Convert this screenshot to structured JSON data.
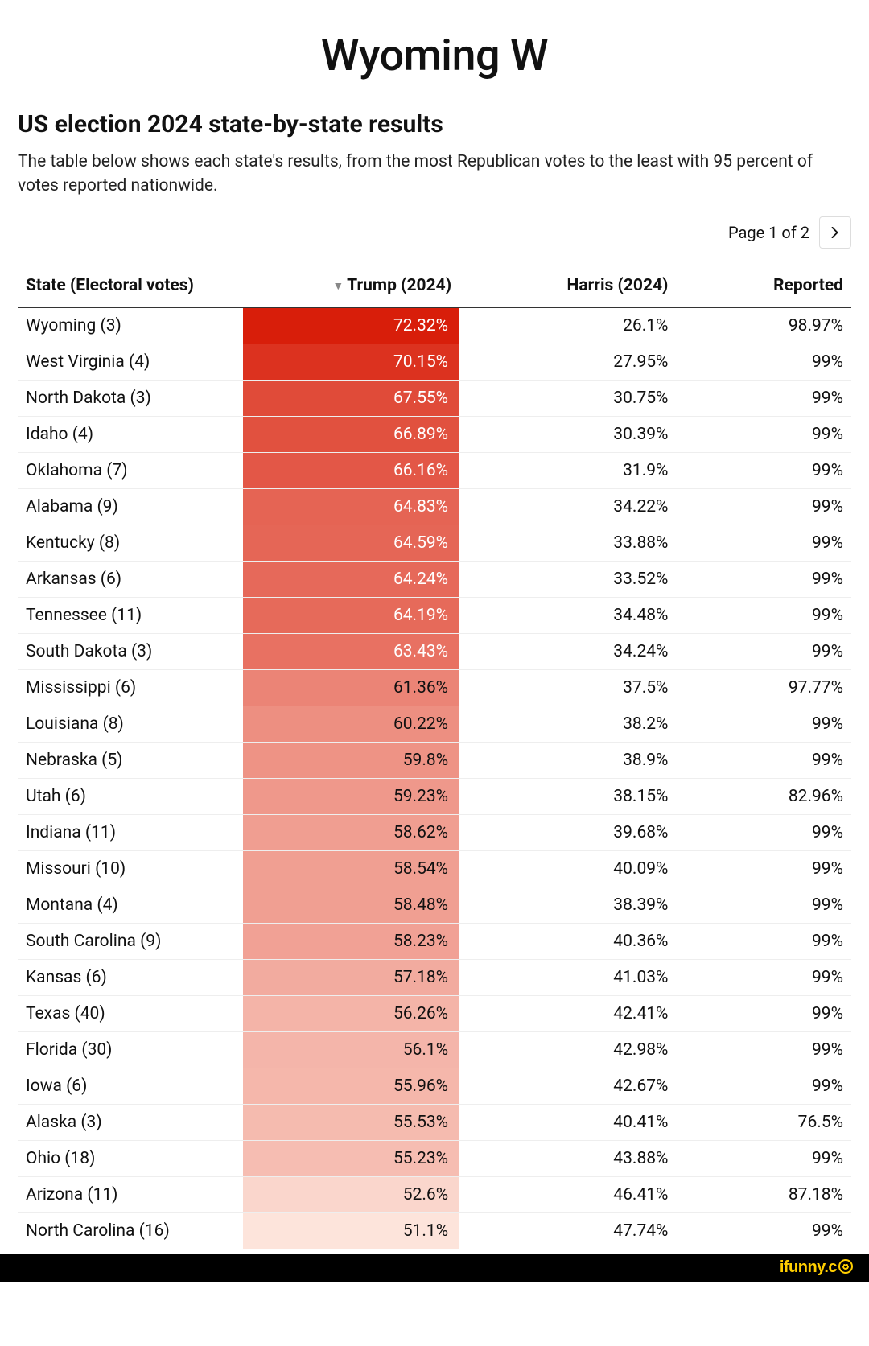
{
  "title": "Wyoming W",
  "subtitle": "US election 2024 state-by-state results",
  "description": "The table below shows each state's results, from the most Republican votes to the least with 95 percent of votes reported nationwide.",
  "pager": {
    "label": "Page 1 of 2"
  },
  "columns": {
    "state": "State (Electoral votes)",
    "trump": "Trump (2024)",
    "harris": "Harris (2024)",
    "reported": "Reported"
  },
  "watermark": "ifunny.c",
  "chart_data": {
    "type": "table",
    "title": "US election 2024 state-by-state results",
    "columns": [
      "State (Electoral votes)",
      "Trump (2024)",
      "Harris (2024)",
      "Reported"
    ],
    "sorted_by": "Trump (2024)",
    "sort_direction": "desc",
    "rows": [
      {
        "state": "Wyoming (3)",
        "trump": "72.32%",
        "harris": "26.1%",
        "reported": "98.97%"
      },
      {
        "state": "West Virginia (4)",
        "trump": "70.15%",
        "harris": "27.95%",
        "reported": "99%"
      },
      {
        "state": "North Dakota (3)",
        "trump": "67.55%",
        "harris": "30.75%",
        "reported": "99%"
      },
      {
        "state": "Idaho (4)",
        "trump": "66.89%",
        "harris": "30.39%",
        "reported": "99%"
      },
      {
        "state": "Oklahoma (7)",
        "trump": "66.16%",
        "harris": "31.9%",
        "reported": "99%"
      },
      {
        "state": "Alabama (9)",
        "trump": "64.83%",
        "harris": "34.22%",
        "reported": "99%"
      },
      {
        "state": "Kentucky (8)",
        "trump": "64.59%",
        "harris": "33.88%",
        "reported": "99%"
      },
      {
        "state": "Arkansas (6)",
        "trump": "64.24%",
        "harris": "33.52%",
        "reported": "99%"
      },
      {
        "state": "Tennessee (11)",
        "trump": "64.19%",
        "harris": "34.48%",
        "reported": "99%"
      },
      {
        "state": "South Dakota (3)",
        "trump": "63.43%",
        "harris": "34.24%",
        "reported": "99%"
      },
      {
        "state": "Mississippi (6)",
        "trump": "61.36%",
        "harris": "37.5%",
        "reported": "97.77%"
      },
      {
        "state": "Louisiana (8)",
        "trump": "60.22%",
        "harris": "38.2%",
        "reported": "99%"
      },
      {
        "state": "Nebraska (5)",
        "trump": "59.8%",
        "harris": "38.9%",
        "reported": "99%"
      },
      {
        "state": "Utah (6)",
        "trump": "59.23%",
        "harris": "38.15%",
        "reported": "82.96%"
      },
      {
        "state": "Indiana (11)",
        "trump": "58.62%",
        "harris": "39.68%",
        "reported": "99%"
      },
      {
        "state": "Missouri (10)",
        "trump": "58.54%",
        "harris": "40.09%",
        "reported": "99%"
      },
      {
        "state": "Montana (4)",
        "trump": "58.48%",
        "harris": "38.39%",
        "reported": "99%"
      },
      {
        "state": "South Carolina (9)",
        "trump": "58.23%",
        "harris": "40.36%",
        "reported": "99%"
      },
      {
        "state": "Kansas (6)",
        "trump": "57.18%",
        "harris": "41.03%",
        "reported": "99%"
      },
      {
        "state": "Texas (40)",
        "trump": "56.26%",
        "harris": "42.41%",
        "reported": "99%"
      },
      {
        "state": "Florida (30)",
        "trump": "56.1%",
        "harris": "42.98%",
        "reported": "99%"
      },
      {
        "state": "Iowa (6)",
        "trump": "55.96%",
        "harris": "42.67%",
        "reported": "99%"
      },
      {
        "state": "Alaska (3)",
        "trump": "55.53%",
        "harris": "40.41%",
        "reported": "76.5%"
      },
      {
        "state": "Ohio (18)",
        "trump": "55.23%",
        "harris": "43.88%",
        "reported": "99%"
      },
      {
        "state": "Arizona (11)",
        "trump": "52.6%",
        "harris": "46.41%",
        "reported": "87.18%"
      },
      {
        "state": "North Carolina (16)",
        "trump": "51.1%",
        "harris": "47.74%",
        "reported": "99%"
      }
    ]
  }
}
